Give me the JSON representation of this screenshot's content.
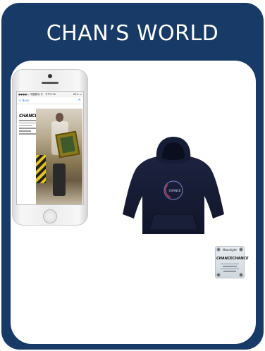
{
  "card": {
    "title": "CHAN’S WORLD",
    "background_color": "#173a66",
    "panel_color": "#ffffff"
  },
  "phone": {
    "status_carrier": "●●●●○ 中国移动 令",
    "status_time": "下午5:28",
    "status_battery": "83% ▭",
    "nav_back": "< Back",
    "nav_close": "✕",
    "article_title": "CHANCECHANCE",
    "icons": [
      "back-chevron-icon",
      "close-icon"
    ]
  },
  "hoodie": {
    "logo_text": "CHANCE",
    "color": "#161b33"
  },
  "tag": {
    "brand": "Moonlight",
    "main": "CHANCECHANCE"
  }
}
